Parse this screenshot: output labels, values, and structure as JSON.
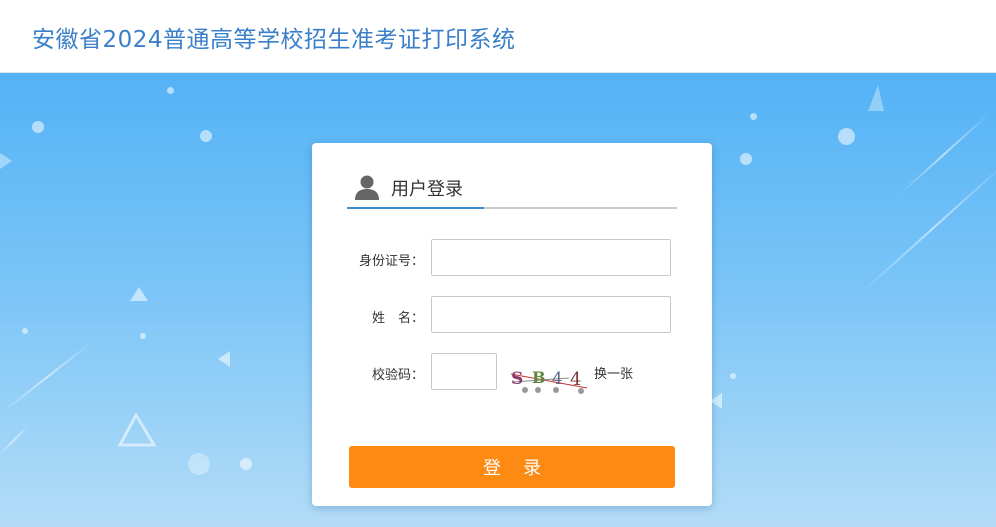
{
  "header": {
    "title": "安徽省2024普通高等学校招生准考证打印系统"
  },
  "login": {
    "title": "用户登录",
    "user_icon": "user-icon",
    "id_label": "身份证号：",
    "id_value": "",
    "name_label": "姓　名：",
    "name_value": "",
    "code_label": "校验码：",
    "code_value": "",
    "captcha_text": "S B 4 4",
    "refresh_label": "换一张",
    "submit_label": "登录"
  },
  "colors": {
    "header_title": "#3a7fc9",
    "background_top": "#54b2f6",
    "accent_line": "#3d8ad4",
    "button": "#fd8a12"
  }
}
